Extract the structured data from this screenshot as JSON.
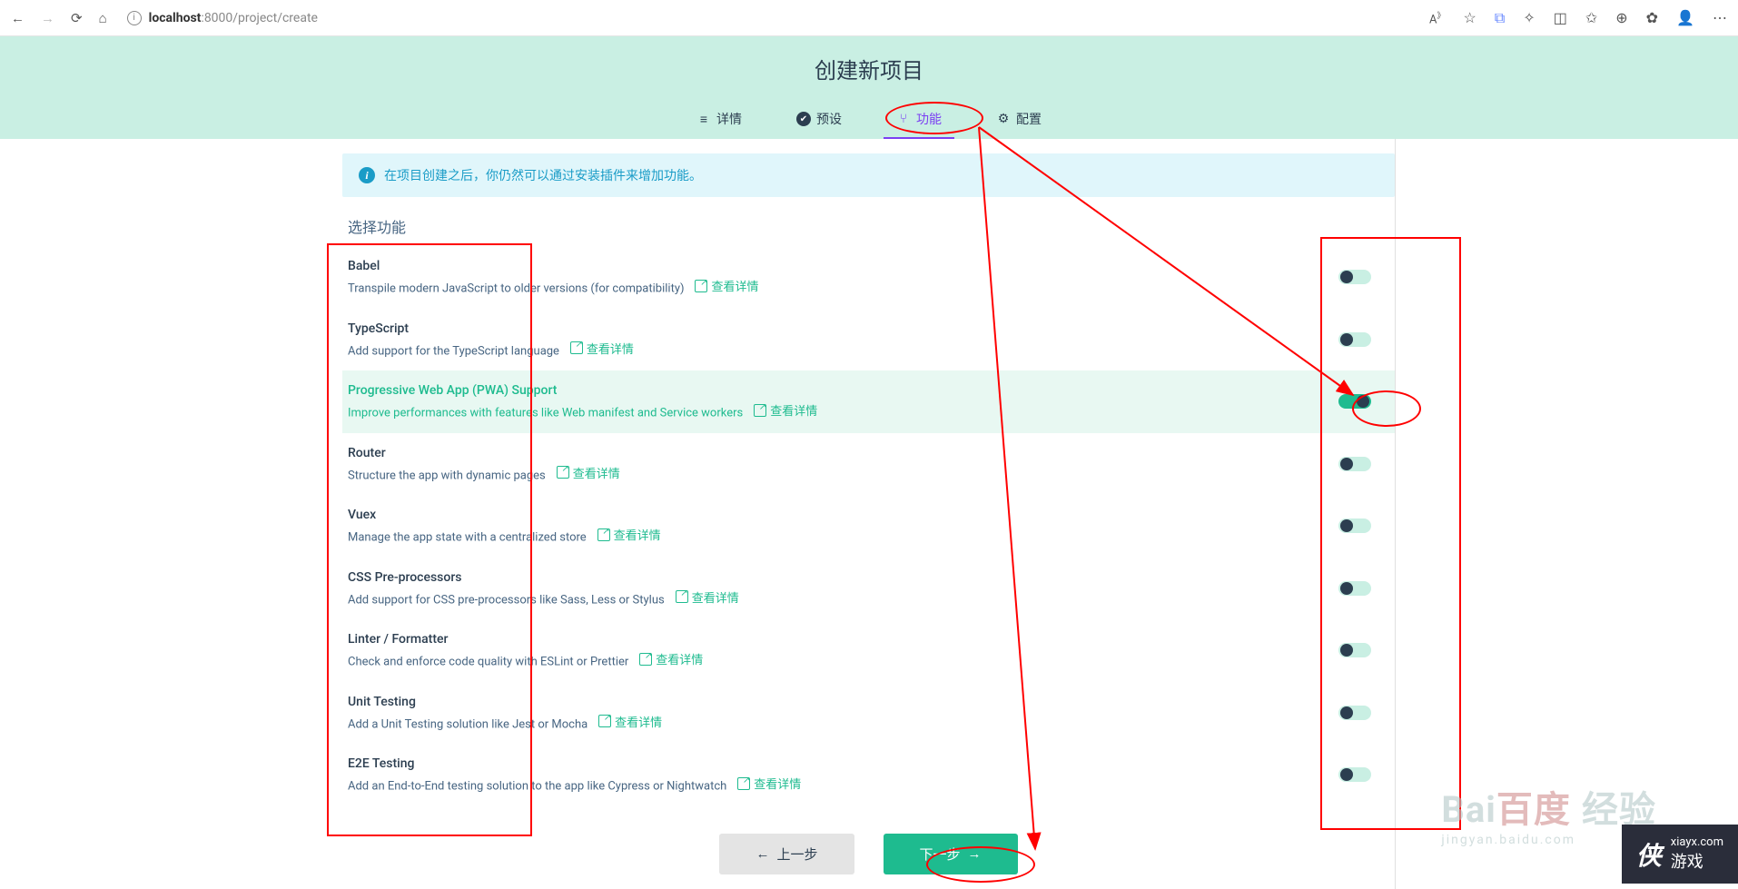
{
  "browser": {
    "url_host": "localhost",
    "url_path": ":8000/project/create",
    "text_size": "A"
  },
  "page": {
    "title": "创建新项目",
    "tabs": [
      {
        "icon": "list",
        "label": "详情"
      },
      {
        "icon": "check",
        "label": "预设"
      },
      {
        "icon": "branch",
        "label": "功能"
      },
      {
        "icon": "gear",
        "label": "配置"
      }
    ],
    "active_tab": 2,
    "info_banner": "在项目创建之后，你仍然可以通过安装插件来增加功能。",
    "section_title": "选择功能",
    "detail_link_label": "查看详情",
    "features": [
      {
        "title": "Babel",
        "desc": "Transpile modern JavaScript to older versions (for compatibility)",
        "enabled": false
      },
      {
        "title": "TypeScript",
        "desc": "Add support for the TypeScript language",
        "enabled": false
      },
      {
        "title": "Progressive Web App (PWA) Support",
        "desc": "Improve performances with features like Web manifest and Service workers",
        "enabled": true,
        "highlighted": true
      },
      {
        "title": "Router",
        "desc": "Structure the app with dynamic pages",
        "enabled": false
      },
      {
        "title": "Vuex",
        "desc": "Manage the app state with a centralized store",
        "enabled": false
      },
      {
        "title": "CSS Pre-processors",
        "desc": "Add support for CSS pre-processors like Sass, Less or Stylus",
        "enabled": false
      },
      {
        "title": "Linter / Formatter",
        "desc": "Check and enforce code quality with ESLint or Prettier",
        "enabled": false
      },
      {
        "title": "Unit Testing",
        "desc": "Add a Unit Testing solution like Jest or Mocha",
        "enabled": false
      },
      {
        "title": "E2E Testing",
        "desc": "Add an End-to-End testing solution to the app like Cypress or Nightwatch",
        "enabled": false
      }
    ],
    "buttons": {
      "prev": "上一步",
      "next": "下一步"
    }
  },
  "watermark": {
    "baidu": "Bai",
    "du": "百度",
    "jy": "经验",
    "url": "jingyan.baidu.com",
    "xia_logo": "侠",
    "xia_text1": "xiayx.com",
    "xia_text2": "游戏"
  }
}
